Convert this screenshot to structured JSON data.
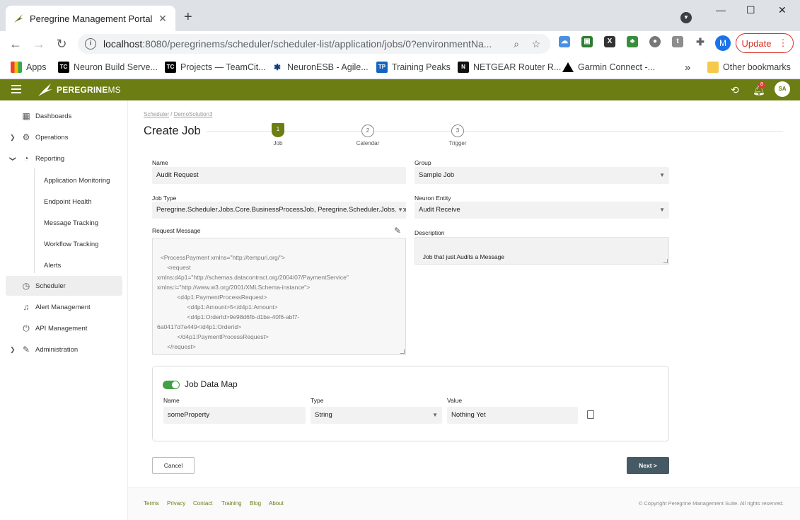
{
  "browser": {
    "tab_title": "Peregrine Management Portal",
    "tab_close": "✕",
    "new_tab": "+",
    "url_host": "localhost",
    "url_rest": ":8080/peregrinems/scheduler/scheduler-list/application/jobs/0?environmentNa...",
    "update_label": "Update",
    "profile_initial": "M",
    "ext_labels": [
      "X",
      "t"
    ],
    "bookmarks": [
      {
        "label": "Apps",
        "icon": "apps-grid-icon",
        "icon_text": ""
      },
      {
        "label": "Neuron Build Serve...",
        "icon": "teamcity-icon",
        "icon_text": "TC"
      },
      {
        "label": "Projects — TeamCit...",
        "icon": "teamcity-icon",
        "icon_text": "TC"
      },
      {
        "label": "NeuronESB - Agile...",
        "icon": "agile-icon",
        "icon_text": "✱"
      },
      {
        "label": "Training Peaks",
        "icon": "trainingpeaks-icon",
        "icon_text": "TP"
      },
      {
        "label": "NETGEAR Router R...",
        "icon": "netgear-icon",
        "icon_text": "N"
      },
      {
        "label": "Garmin Connect -...",
        "icon": "garmin-icon",
        "icon_text": ""
      }
    ],
    "more_bookmarks": "»",
    "other_bookmarks": "Other bookmarks"
  },
  "app": {
    "brand_main": "PEREGRINE",
    "brand_suffix": "MS",
    "notification_count": "8",
    "user_initials": "SA",
    "accent": "#6b7d13"
  },
  "sidebar": {
    "items": [
      {
        "label": "Dashboards",
        "icon": "dashboard-icon"
      },
      {
        "label": "Operations",
        "icon": "gear-icon"
      },
      {
        "label": "Reporting",
        "icon": "pie-chart-icon"
      },
      {
        "label": "Scheduler",
        "icon": "clock-icon"
      },
      {
        "label": "Alert Management",
        "icon": "bell-icon"
      },
      {
        "label": "API Management",
        "icon": "plug-icon"
      },
      {
        "label": "Administration",
        "icon": "wrench-icon"
      }
    ],
    "reporting_sub": [
      "Application Monitoring",
      "Endpoint Health",
      "Message Tracking",
      "Workflow Tracking",
      "Alerts"
    ]
  },
  "main": {
    "breadcrumb_root": "Scheduler",
    "breadcrumb_sep": " / ",
    "breadcrumb_current": "DemoSolution3",
    "title": "Create Job",
    "steps": [
      {
        "num": "1",
        "label": "Job"
      },
      {
        "num": "2",
        "label": "Calendar"
      },
      {
        "num": "3",
        "label": "Trigger"
      }
    ],
    "form": {
      "name_label": "Name",
      "name_value": "Audit Request",
      "group_label": "Group",
      "group_value": "Sample Job",
      "job_type_label": "Job Type",
      "job_type_value": "Peregrine.Scheduler.Jobs.Core.BusinessProcessJob, Peregrine.Scheduler.Jobs.Core",
      "entity_label": "Neuron Entity",
      "entity_value": "Audit Receive",
      "request_label": "Request Message",
      "request_value": "<ProcessPayment xmlns=\"http://tempuri.org/\">\n      <request\nxmlns:d4p1=\"http://schemas.datacontract.org/2004/07/PaymentService\"\nxmlns:i=\"http://www.w3.org/2001/XMLSchema-instance\">\n            <d4p1:PaymentProcessRequest>\n                  <d4p1:Amount>5</d4p1:Amount>\n                  <d4p1:OrderId>9e98d6fb-d1be-40f6-abf7-\n6a0417d7e449</d4p1:OrderId>\n            </d4p1:PaymentProcessRequest>\n      </request>\n</ProcessPayment>",
      "description_label": "Description",
      "description_value": "Job that just Audits a Message"
    },
    "job_data_map": {
      "title": "Job Data Map",
      "name_label": "Name",
      "type_label": "Type",
      "value_label": "Value",
      "name_value": "someProperty",
      "type_value": "String",
      "value_value": "Nothing Yet"
    },
    "cancel_label": "Cancel",
    "next_label": "Next >"
  },
  "footer": {
    "links": [
      "Terms",
      "Privacy",
      "Contact",
      "Training",
      "Blog",
      "About"
    ],
    "copyright": "© Copyright Peregrine Management Suite. All rights reserved."
  }
}
